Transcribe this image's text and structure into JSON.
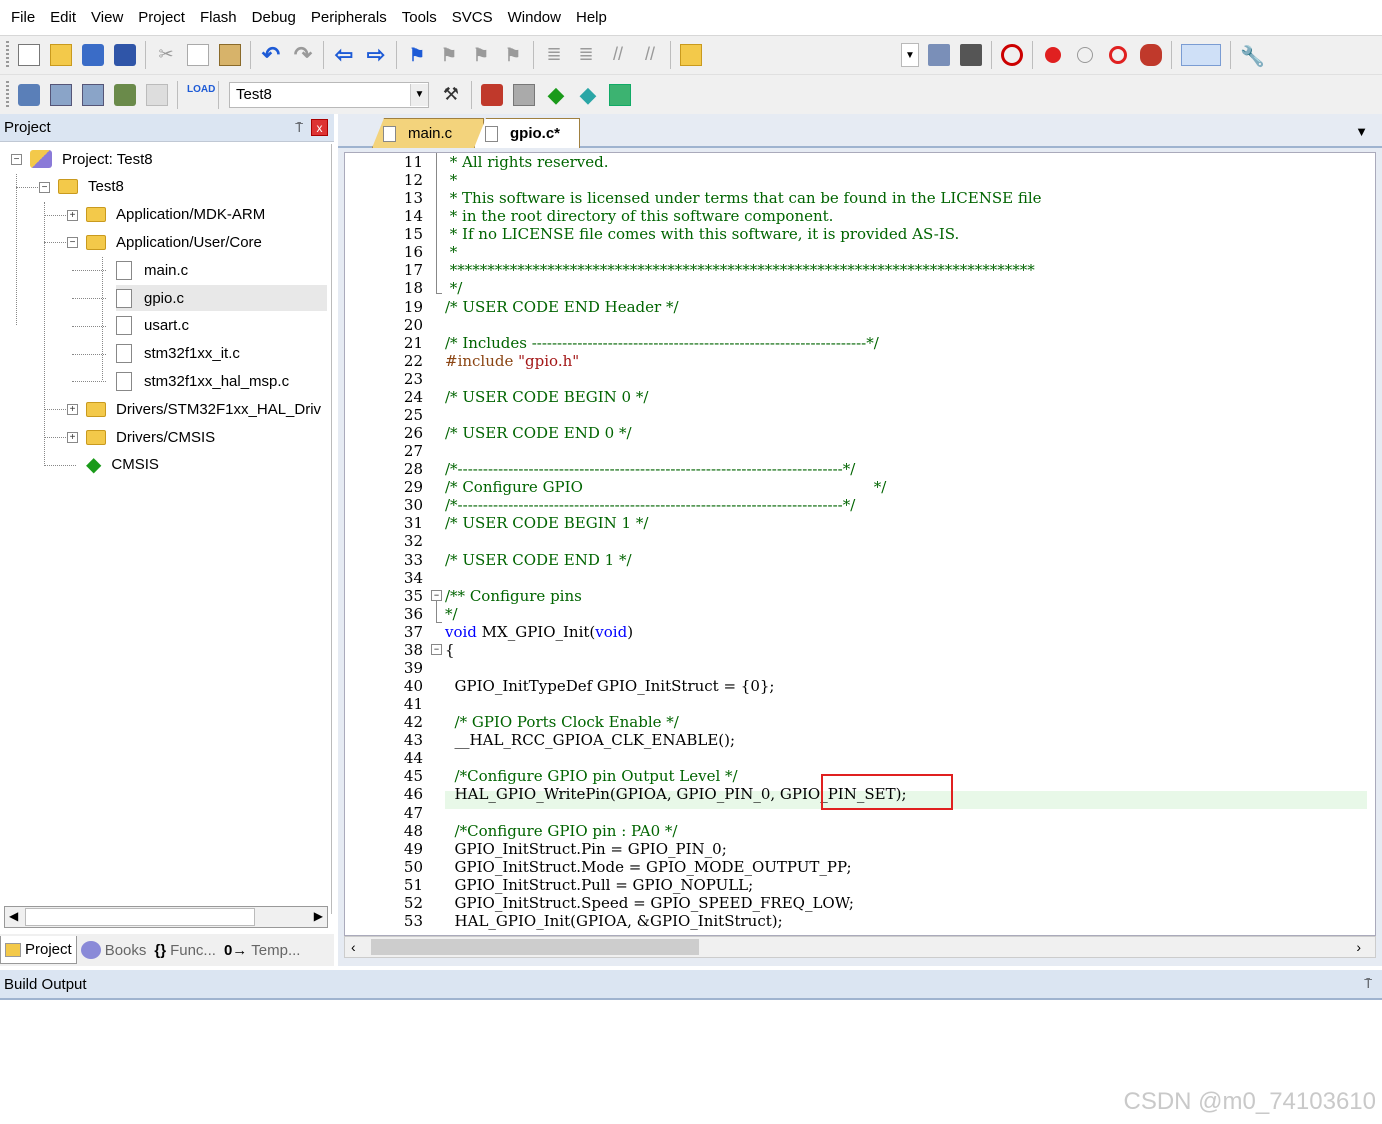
{
  "menu": [
    "File",
    "Edit",
    "View",
    "Project",
    "Flash",
    "Debug",
    "Peripherals",
    "Tools",
    "SVCS",
    "Window",
    "Help"
  ],
  "toolbar2": {
    "target": "Test8"
  },
  "project_panel": {
    "title": "Project",
    "pin": "⍑",
    "close": "x",
    "tree": [
      {
        "label": "Project: Test8",
        "level": 0,
        "icon": "project-icon",
        "expander": "-"
      },
      {
        "label": "Test8",
        "level": 1,
        "icon": "target-folder-icon",
        "expander": "-"
      },
      {
        "label": "Application/MDK-ARM",
        "level": 2,
        "icon": "folder-icon",
        "expander": "+"
      },
      {
        "label": "Application/User/Core",
        "level": 2,
        "icon": "folder-open-icon",
        "expander": "-"
      },
      {
        "label": "main.c",
        "level": 3,
        "icon": "file-icon"
      },
      {
        "label": "gpio.c",
        "level": 3,
        "icon": "file-icon",
        "selected": true
      },
      {
        "label": "usart.c",
        "level": 3,
        "icon": "file-icon"
      },
      {
        "label": "stm32f1xx_it.c",
        "level": 3,
        "icon": "file-icon"
      },
      {
        "label": "stm32f1xx_hal_msp.c",
        "level": 3,
        "icon": "file-icon"
      },
      {
        "label": "Drivers/STM32F1xx_HAL_Driv",
        "level": 2,
        "icon": "folder-icon",
        "expander": "+"
      },
      {
        "label": "Drivers/CMSIS",
        "level": 2,
        "icon": "folder-icon",
        "expander": "+"
      },
      {
        "label": "CMSIS",
        "level": 2,
        "icon": "cmsis-icon"
      }
    ],
    "tabs": [
      {
        "label": "Project"
      },
      {
        "label": "Books"
      },
      {
        "label": "Func..."
      },
      {
        "label": "Temp..."
      }
    ]
  },
  "editor": {
    "tabs": [
      {
        "label": "main.c",
        "active": false
      },
      {
        "label": "gpio.c*",
        "active": true
      }
    ],
    "lines": [
      {
        "n": "11",
        "t": " * All rights reserved.",
        "c": "cm"
      },
      {
        "n": "12",
        "t": " *",
        "c": "cm"
      },
      {
        "n": "13",
        "t": " * This software is licensed under terms that can be found in the LICENSE file",
        "c": "cm"
      },
      {
        "n": "14",
        "t": " * in the root directory of this software component.",
        "c": "cm"
      },
      {
        "n": "15",
        "t": " * If no LICENSE file comes with this software, it is provided AS-IS.",
        "c": "cm"
      },
      {
        "n": "16",
        "t": " *",
        "c": "cm"
      },
      {
        "n": "17",
        "t": " ******************************************************************************",
        "c": "cm"
      },
      {
        "n": "18",
        "t": " */",
        "c": "cm"
      },
      {
        "n": "19",
        "t": "/* USER CODE END Header */",
        "c": "cm"
      },
      {
        "n": "20",
        "t": "",
        "c": ""
      },
      {
        "n": "21",
        "t": "/* Includes ------------------------------------------------------------------*/",
        "c": "cm"
      },
      {
        "n": "22",
        "t": "#include \"gpio.h\"",
        "c": "pp"
      },
      {
        "n": "23",
        "t": "",
        "c": ""
      },
      {
        "n": "24",
        "t": "/* USER CODE BEGIN 0 */",
        "c": "cm"
      },
      {
        "n": "25",
        "t": "",
        "c": ""
      },
      {
        "n": "26",
        "t": "/* USER CODE END 0 */",
        "c": "cm"
      },
      {
        "n": "27",
        "t": "",
        "c": ""
      },
      {
        "n": "28",
        "t": "/*----------------------------------------------------------------------------*/",
        "c": "cm"
      },
      {
        "n": "29",
        "t": "/* Configure GPIO                                                             */",
        "c": "cm"
      },
      {
        "n": "30",
        "t": "/*----------------------------------------------------------------------------*/",
        "c": "cm"
      },
      {
        "n": "31",
        "t": "/* USER CODE BEGIN 1 */",
        "c": "cm"
      },
      {
        "n": "32",
        "t": "",
        "c": ""
      },
      {
        "n": "33",
        "t": "/* USER CODE END 1 */",
        "c": "cm"
      },
      {
        "n": "34",
        "t": "",
        "c": ""
      },
      {
        "n": "35",
        "t": "/** Configure pins",
        "c": "cm"
      },
      {
        "n": "36",
        "t": "*/",
        "c": "cm"
      },
      {
        "n": "37",
        "t": "void MX_GPIO_Init(void)",
        "c": "fn"
      },
      {
        "n": "38",
        "t": "{",
        "c": ""
      },
      {
        "n": "39",
        "t": "",
        "c": ""
      },
      {
        "n": "40",
        "t": "  GPIO_InitTypeDef GPIO_InitStruct = {0};",
        "c": ""
      },
      {
        "n": "41",
        "t": "",
        "c": ""
      },
      {
        "n": "42",
        "t": "  /* GPIO Ports Clock Enable */",
        "c": "cm"
      },
      {
        "n": "43",
        "t": "  __HAL_RCC_GPIOA_CLK_ENABLE();",
        "c": ""
      },
      {
        "n": "44",
        "t": "",
        "c": ""
      },
      {
        "n": "45",
        "t": "  /*Configure GPIO pin Output Level */",
        "c": "cm"
      },
      {
        "n": "46",
        "t": "  HAL_GPIO_WritePin(GPIOA, GPIO_PIN_0, GPIO_PIN_SET);",
        "c": ""
      },
      {
        "n": "47",
        "t": "",
        "c": ""
      },
      {
        "n": "48",
        "t": "  /*Configure GPIO pin : PA0 */",
        "c": "cm"
      },
      {
        "n": "49",
        "t": "  GPIO_InitStruct.Pin = GPIO_PIN_0;",
        "c": ""
      },
      {
        "n": "50",
        "t": "  GPIO_InitStruct.Mode = GPIO_MODE_OUTPUT_PP;",
        "c": ""
      },
      {
        "n": "51",
        "t": "  GPIO_InitStruct.Pull = GPIO_NOPULL;",
        "c": ""
      },
      {
        "n": "52",
        "t": "  GPIO_InitStruct.Speed = GPIO_SPEED_FREQ_LOW;",
        "c": ""
      },
      {
        "n": "53",
        "t": "  HAL_GPIO_Init(GPIOA, &GPIO_InitStruct);",
        "c": ""
      }
    ]
  },
  "build_output": {
    "title": "Build Output",
    "pin": "⍑"
  },
  "watermark": "CSDN @m0_74103610",
  "colors": {
    "comment": "#006400",
    "keyword": "#0000ff",
    "highlight_box": "#e02020",
    "panel_header": "#dbe5f2"
  }
}
